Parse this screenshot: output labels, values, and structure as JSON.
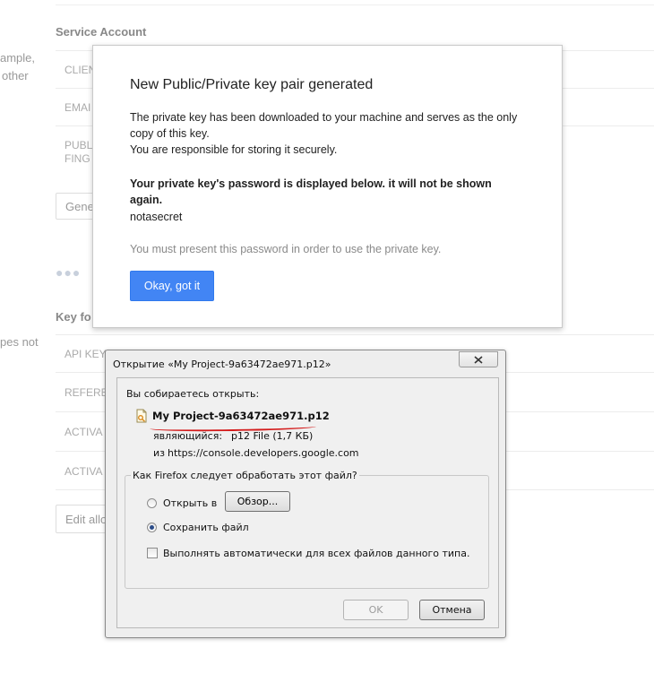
{
  "background": {
    "left_fragments": [
      "ample,",
      "other",
      "pes not"
    ],
    "service_account_title": "Service Account",
    "service_rows": [
      "CLIEN",
      "EMAI",
      "PUBL",
      "FING"
    ],
    "generate_button": "Gene",
    "keys_title": "Key fo",
    "key_rows": [
      "API KEY",
      "REFERE",
      "ACTIVA",
      "ACTIVA"
    ],
    "edit_button": "Edit allo"
  },
  "key_dialog": {
    "title": "New Public/Private key pair generated",
    "paragraph1": "The private key has been downloaded to your machine and serves as the only copy of this key.",
    "paragraph1b": "You are responsible for storing it securely.",
    "warning": "Your private key's password is displayed below. it will not be shown again.",
    "password": "notasecret",
    "note": "You must present this password in order to use the private key.",
    "ok_label": "Okay, got it",
    "accent": "#4285f4"
  },
  "firefox_dialog": {
    "title": "Открытие «My Project-9a63472ae971.p12»",
    "prompt": "Вы собираетесь открыть:",
    "file_icon": "file-icon",
    "filename": "My Project-9a63472ae971.p12",
    "type_label": "являющийся:",
    "type_value": "p12 File (1,7 КБ)",
    "from_label": "из",
    "from_value": "https://console.developers.google.com",
    "group_label": "Как Firefox следует обработать этот файл?",
    "open_with_label": "Открыть в",
    "browse_label": "Обзор...",
    "save_file_label": "Сохранить файл",
    "auto_label": "Выполнять автоматически для всех файлов данного типа.",
    "selected_option": "Сохранить файл",
    "ok_label": "OK",
    "cancel_label": "Отмена",
    "highlight_color": "#d41c1c"
  }
}
